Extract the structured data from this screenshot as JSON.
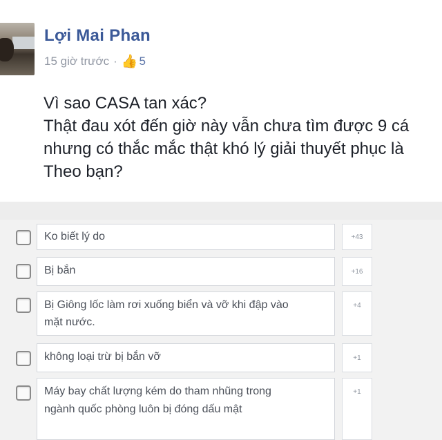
{
  "post": {
    "author": "Lợi Mai Phan",
    "time": "15 giờ trước",
    "separator": "·",
    "like_icon": "thumbs-up-icon",
    "like_count": "5",
    "lines": [
      "Vì sao CASA tan xác?",
      "Thật đau xót đến giờ này vẫn chưa tìm được 9 cá",
      "nhưng có thắc mắc thật khó lý giải thuyết phục là",
      "Theo bạn?"
    ]
  },
  "poll": {
    "options": [
      {
        "label": "Ko biết lý do",
        "count": "+43"
      },
      {
        "label": "Bị bắn",
        "count": "+16"
      },
      {
        "label": "Bị Giông lốc làm rơi xuống biển và vỡ khi đập vào mặt nước.",
        "count": "+4"
      },
      {
        "label": "không loại trừ bị bắn vỡ",
        "count": "+1"
      },
      {
        "label": "Máy bay chất lượng kém do tham nhũng trong ngành quốc phòng luôn bị đóng dấu mật",
        "count": "+1"
      }
    ]
  }
}
